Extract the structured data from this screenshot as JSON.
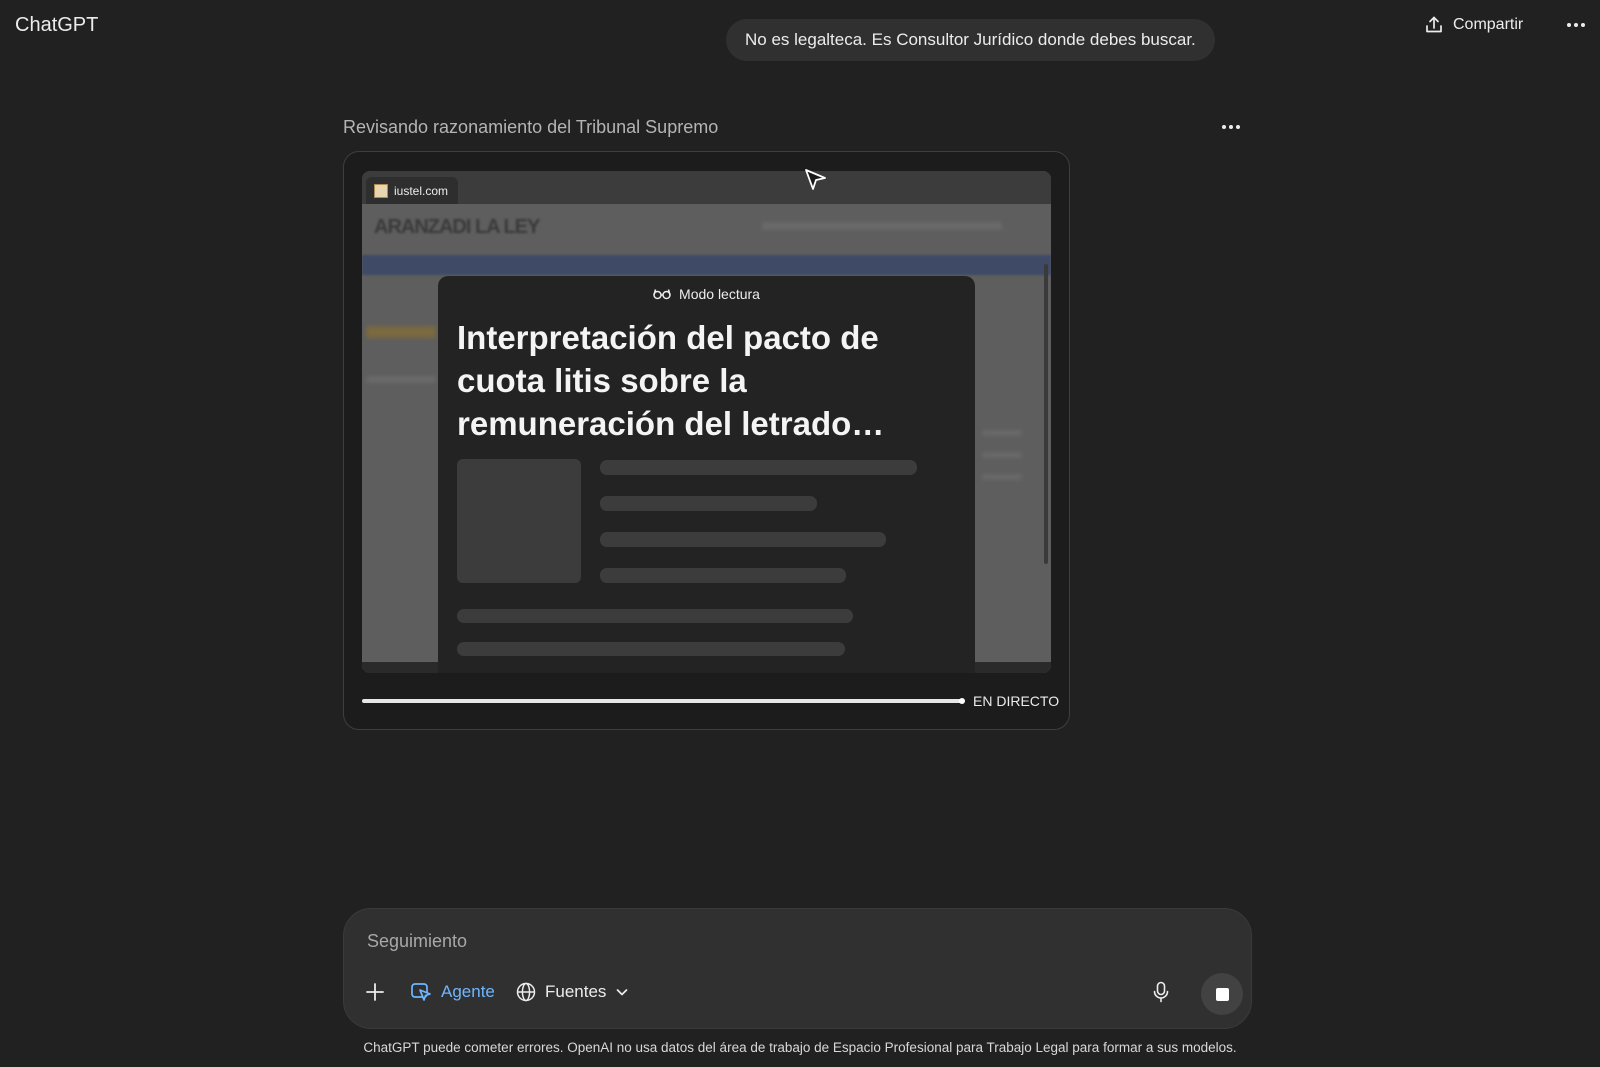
{
  "header": {
    "app_title": "ChatGPT",
    "share_label": "Compartir",
    "share_icon": "upload-icon",
    "more_icon": "more-icon"
  },
  "conversation": {
    "user_message": "No es legalteca. Es Consultor Jurídico donde debes buscar.",
    "reasoning_title": "Revisando razonamiento del Tribunal Supremo"
  },
  "browser": {
    "tab_label": "iustel.com",
    "page_logo": "ARANZADI LA LEY",
    "reader_mode_label": "Modo lectura",
    "article_title": "Interpretación del pacto de cuota litis sobre la remuneración del letrado…",
    "progress": 1.0,
    "live_label": "EN DIRECTO"
  },
  "composer": {
    "placeholder": "Seguimiento",
    "value": "",
    "agent_label": "Agente",
    "sources_label": "Fuentes"
  },
  "footer": {
    "disclaimer": "ChatGPT puede cometer errores. OpenAI no usa datos del área de trabajo de Espacio Profesional para Trabajo Legal para formar a sus modelos."
  },
  "colors": {
    "background": "#212121",
    "bubble": "#303030",
    "accent": "#6fb6ff"
  }
}
